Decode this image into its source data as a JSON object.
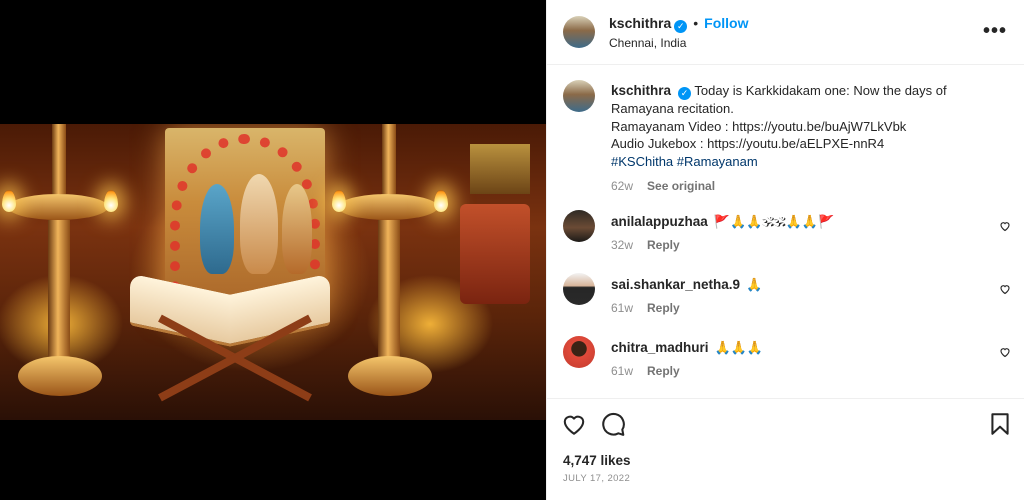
{
  "post": {
    "author": {
      "username": "kschithra",
      "verified_icon": "verified-badge-icon",
      "follow_label": "Follow",
      "location": "Chennai, India"
    },
    "more_icon": "more-options-icon",
    "caption": {
      "username": "kschithra",
      "text_line1": "Today is Karkkidakam one: Now the days of",
      "text_line2": "Ramayana recitation.",
      "text_line3": "Ramayanam Video : https://youtu.be/buAjW7LkVbk",
      "text_line4": "Audio Jukebox : https://youtu.be/aELPXE-nnR4",
      "hashtags": "#KSChitha #Ramayanam",
      "time": "62w",
      "see_original": "See original"
    },
    "comments": [
      {
        "username": "anilalappuzhaa",
        "text": "🚩🙏🙏🕉🕉🙏🙏🚩",
        "time": "32w",
        "reply": "Reply"
      },
      {
        "username": "sai.shankar_netha.9",
        "text": "🙏",
        "time": "61w",
        "reply": "Reply"
      },
      {
        "username": "chitra_madhuri",
        "text": "🙏🙏🙏",
        "time": "61w",
        "reply": "Reply"
      }
    ],
    "likes": "4,747 likes",
    "date": "JULY 17, 2022"
  },
  "colors": {
    "accent": "#0095f6",
    "hashtag": "#00376b",
    "muted": "#8e8e8e",
    "text": "#262626"
  }
}
